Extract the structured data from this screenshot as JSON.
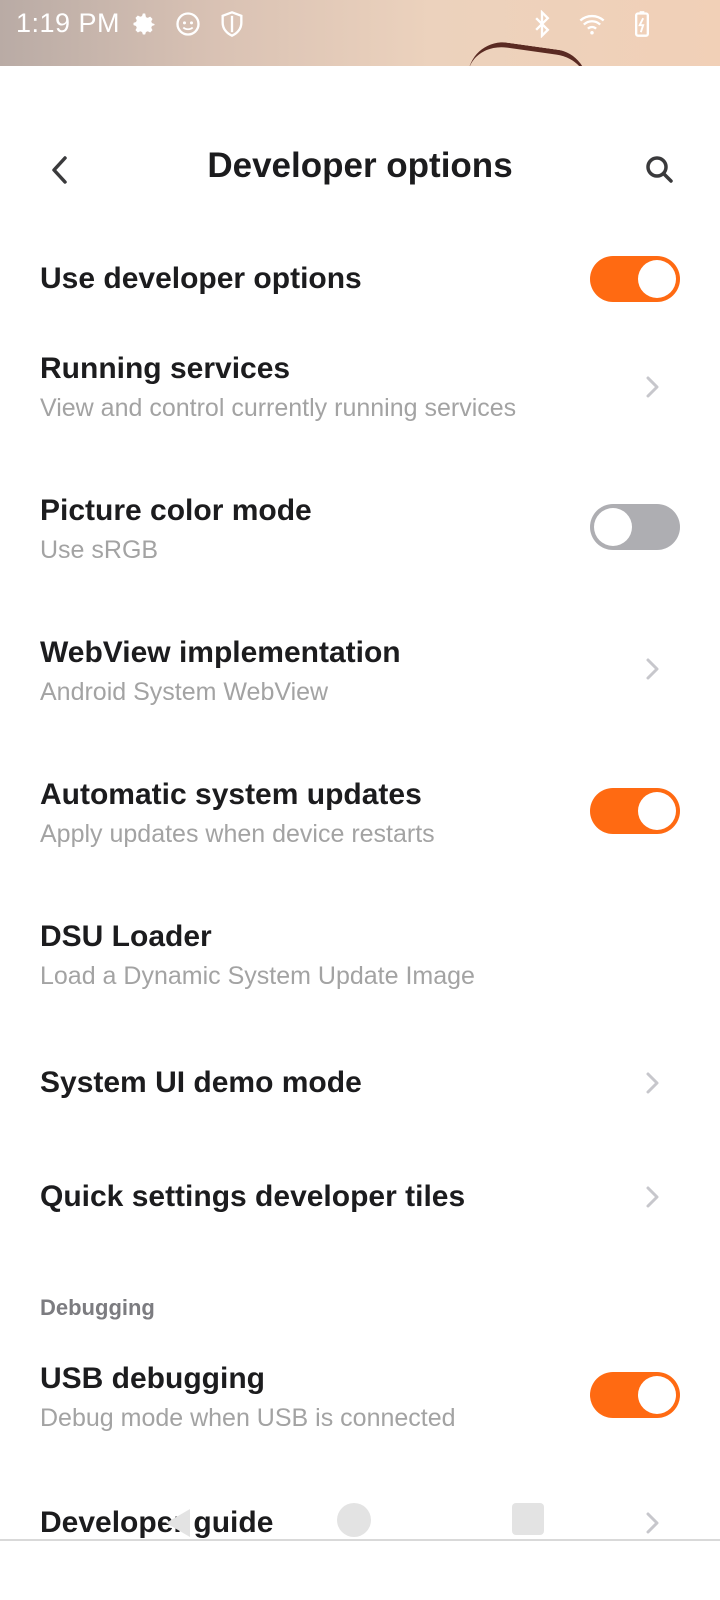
{
  "status_bar": {
    "time": "1:19 PM",
    "left_icons": [
      "gear-icon",
      "face-icon",
      "shield-icon"
    ],
    "right_icons": [
      "bluetooth-icon",
      "wifi-icon",
      "battery-icon"
    ]
  },
  "header": {
    "title": "Developer options",
    "back_icon": "chevron-left-icon",
    "search_icon": "search-icon"
  },
  "settings": [
    {
      "title": "Use developer options",
      "subtitle": "",
      "control": "toggle",
      "state": "on"
    },
    {
      "title": "Running services",
      "subtitle": "View and control currently running services",
      "control": "chevron"
    },
    {
      "title": "Picture color mode",
      "subtitle": "Use sRGB",
      "control": "toggle",
      "state": "off"
    },
    {
      "title": "WebView implementation",
      "subtitle": "Android System WebView",
      "control": "chevron"
    },
    {
      "title": "Automatic system updates",
      "subtitle": "Apply updates when device restarts",
      "control": "toggle",
      "state": "on"
    },
    {
      "title": "DSU Loader",
      "subtitle": "Load a Dynamic System Update Image",
      "control": "none"
    },
    {
      "title": "System UI demo mode",
      "subtitle": "",
      "control": "chevron"
    },
    {
      "title": "Quick settings developer tiles",
      "subtitle": "",
      "control": "chevron"
    }
  ],
  "debugging": {
    "section_label": "Debugging",
    "items": [
      {
        "title": "USB debugging",
        "subtitle": "Debug mode when USB is connected",
        "control": "toggle",
        "state": "on"
      },
      {
        "title": "Developer guide",
        "subtitle": "",
        "control": "chevron"
      }
    ]
  },
  "colors": {
    "accent": "#ff6a12",
    "toggle_off": "#aeaeb2",
    "subtitle": "#a3a3a3"
  },
  "navbar": {
    "icons": [
      "nav-back-icon",
      "nav-home-icon",
      "nav-recents-icon"
    ]
  }
}
